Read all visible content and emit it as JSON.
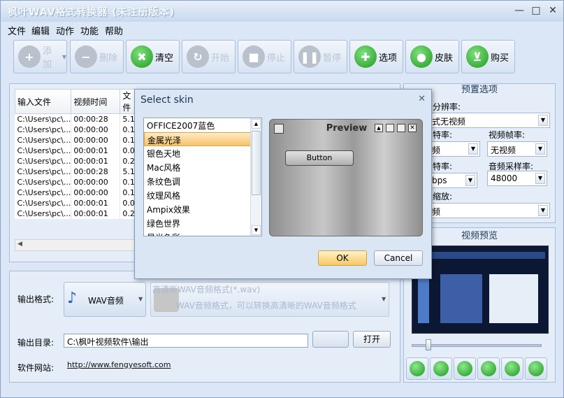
{
  "window": {
    "title": "枫叶WAV格式转换器  (未注册版本)",
    "controls": [
      "—",
      "□",
      "✕"
    ]
  },
  "menu": [
    "文件",
    "编辑",
    "动作",
    "功能",
    "帮助"
  ],
  "toolbar": [
    {
      "label": "添加",
      "icon": "plus-icon",
      "enabled": false
    },
    {
      "label": "删除",
      "icon": "minus-icon",
      "enabled": false
    },
    {
      "label": "清空",
      "icon": "clear-icon",
      "enabled": true
    },
    {
      "label": "开始",
      "icon": "refresh-icon",
      "enabled": false
    },
    {
      "label": "停止",
      "icon": "stop-icon",
      "enabled": false
    },
    {
      "label": "暂停",
      "icon": "pause-icon",
      "enabled": false
    },
    {
      "label": "选项",
      "icon": "tools-icon",
      "enabled": true
    },
    {
      "label": "皮肤",
      "icon": "apple-icon",
      "enabled": true
    },
    {
      "label": "购买",
      "icon": "cart-icon",
      "enabled": true
    }
  ],
  "file_table": {
    "columns": [
      "输入文件",
      "视频时间",
      "文件"
    ],
    "rows": [
      [
        "C:\\Users\\pc\\...",
        "00:00:28",
        "5.1"
      ],
      [
        "C:\\Users\\pc\\...",
        "00:00:00",
        "0.1"
      ],
      [
        "C:\\Users\\pc\\...",
        "00:00:00",
        "0.1"
      ],
      [
        "C:\\Users\\pc\\...",
        "00:00:01",
        "0.0"
      ],
      [
        "C:\\Users\\pc\\...",
        "00:00:01",
        "0.2"
      ],
      [
        "C:\\Users\\pc\\...",
        "00:00:28",
        "5.1"
      ],
      [
        "C:\\Users\\pc\\...",
        "00:00:00",
        "0.1"
      ],
      [
        "C:\\Users\\pc\\...",
        "00:00:00",
        "0.1"
      ],
      [
        "C:\\Users\\pc\\...",
        "00:00:01",
        "0.0"
      ],
      [
        "C:\\Users\\pc\\...",
        "00:00:01",
        "0.2"
      ]
    ]
  },
  "output": {
    "format_label": "输出格式:",
    "format_value": "WAV音频",
    "format_title": "高清晰WAV音频格式(*.wav)",
    "format_desc": "WAV音频格式，可以转换高清晰的WAV音频格式",
    "dir_label": "输出目录:",
    "dir_value": "C:\\枫叶视频软件\\输出",
    "open_label": "打开",
    "site_label": "软件网站:",
    "site_url": "http://www.fengyesoft.com"
  },
  "preset": {
    "header": "预置选项",
    "resolution_label": "分辨率:",
    "resolution_value": "式无视频",
    "vbitrate_label": "特率:",
    "vbitrate_value": "频",
    "framerate_label": "视频帧率:",
    "framerate_value": "无视频",
    "abitrate_label": "特率:",
    "abitrate_value": "bps",
    "samplerate_label": "音频采样率:",
    "samplerate_value": "48000",
    "zoom_label": "缩放:",
    "zoom_value": "频"
  },
  "video_preview": {
    "header": "视频预览"
  },
  "dialog": {
    "title": "Select skin",
    "skins": [
      "OFFICE2007蓝色",
      "金属光泽",
      "银色天地",
      "Mac风格",
      "条纹色调",
      "纹理风格",
      "Ampix效果",
      "绿色世界",
      "晨光色彩"
    ],
    "selected_index": 1,
    "preview_title": "Preview",
    "preview_button": "Button",
    "ok": "OK",
    "cancel": "Cancel"
  }
}
